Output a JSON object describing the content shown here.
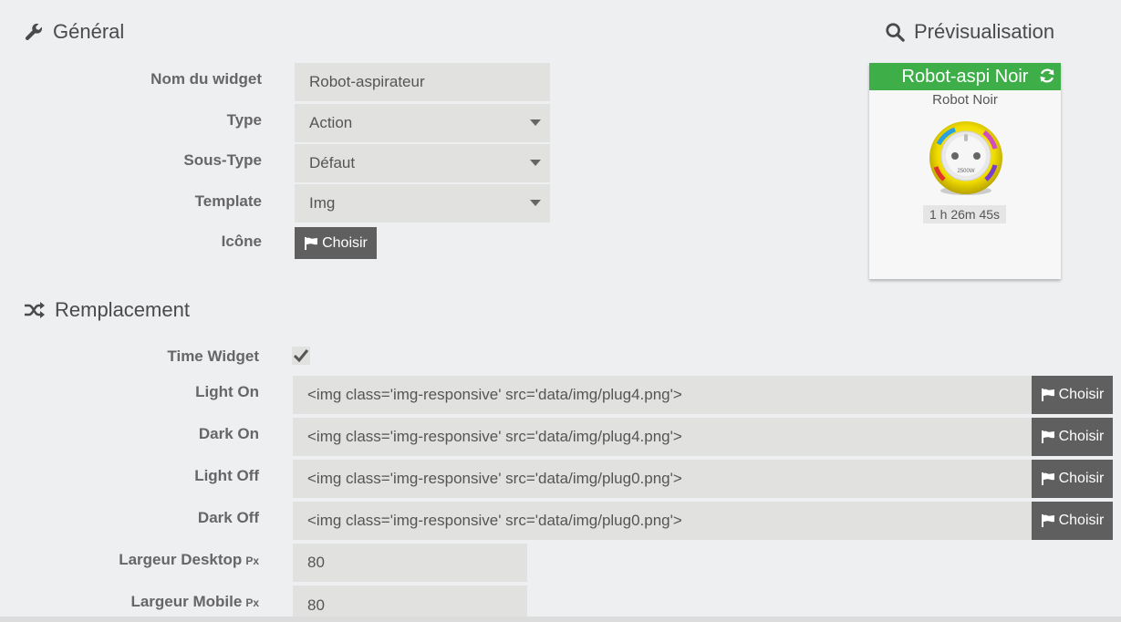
{
  "general": {
    "title": "Général",
    "name_label": "Nom du widget",
    "name_value": "Robot-aspirateur",
    "type_label": "Type",
    "type_value": "Action",
    "subtype_label": "Sous-Type",
    "subtype_value": "Défaut",
    "template_label": "Template",
    "template_value": "Img",
    "icon_label": "Icône",
    "choose_label": "Choisir"
  },
  "preview": {
    "title": "Prévisualisation",
    "widget_title": "Robot-aspi Noir",
    "widget_subtitle": "Robot Noir",
    "duration": "1 h 26m 45s",
    "plug_text": "2500W",
    "header_color": "#3eae49"
  },
  "replacement": {
    "title": "Remplacement",
    "time_widget_label": "Time Widget",
    "time_widget_checked": true,
    "rows": [
      {
        "label": "Light On",
        "value": "<img class='img-responsive' src='data/img/plug4.png'>",
        "button": "Choisir"
      },
      {
        "label": "Dark On",
        "value": "<img class='img-responsive' src='data/img/plug4.png'>",
        "button": "Choisir"
      },
      {
        "label": "Light Off",
        "value": "<img class='img-responsive' src='data/img/plug0.png'>",
        "button": "Choisir"
      },
      {
        "label": "Dark Off",
        "value": "<img class='img-responsive' src='data/img/plug0.png'>",
        "button": "Choisir"
      }
    ],
    "desktop_label": "Largeur Desktop",
    "desktop_unit": "Px",
    "desktop_value": "80",
    "mobile_label": "Largeur Mobile",
    "mobile_unit": "Px",
    "mobile_value": "80"
  },
  "icons": {
    "general": "wrench-icon",
    "preview": "search-icon",
    "replacement": "shuffle-icon",
    "choose": "flag-icon",
    "refresh": "refresh-icon",
    "check": "check-icon"
  }
}
